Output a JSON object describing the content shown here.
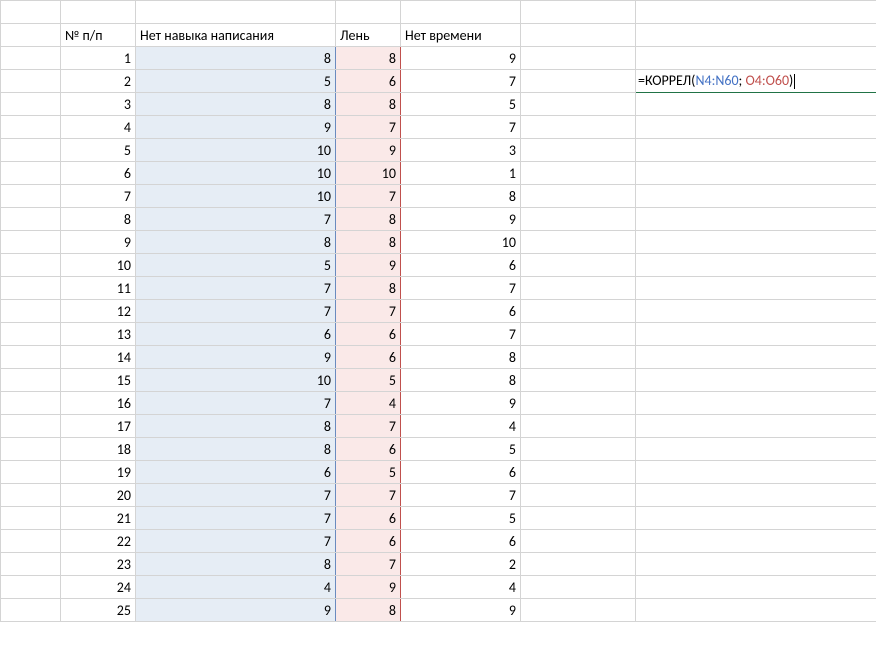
{
  "headers": {
    "index": "№ п/п",
    "col1": "Нет навыка написания",
    "col2": "Лень",
    "col3": "Нет времени"
  },
  "formula": {
    "prefix": "=КОРРЕЛ(",
    "arg1": "N4:N60",
    "sep": "; ",
    "arg2": "O4:O60",
    "suffix": ")"
  },
  "rows": [
    {
      "n": "1",
      "a": "8",
      "b": "8",
      "c": "9"
    },
    {
      "n": "2",
      "a": "5",
      "b": "6",
      "c": "7"
    },
    {
      "n": "3",
      "a": "8",
      "b": "8",
      "c": "5"
    },
    {
      "n": "4",
      "a": "9",
      "b": "7",
      "c": "7"
    },
    {
      "n": "5",
      "a": "10",
      "b": "9",
      "c": "3"
    },
    {
      "n": "6",
      "a": "10",
      "b": "10",
      "c": "1"
    },
    {
      "n": "7",
      "a": "10",
      "b": "7",
      "c": "8"
    },
    {
      "n": "8",
      "a": "7",
      "b": "8",
      "c": "9"
    },
    {
      "n": "9",
      "a": "8",
      "b": "8",
      "c": "10"
    },
    {
      "n": "10",
      "a": "5",
      "b": "9",
      "c": "6"
    },
    {
      "n": "11",
      "a": "7",
      "b": "8",
      "c": "7"
    },
    {
      "n": "12",
      "a": "7",
      "b": "7",
      "c": "6"
    },
    {
      "n": "13",
      "a": "6",
      "b": "6",
      "c": "7"
    },
    {
      "n": "14",
      "a": "9",
      "b": "6",
      "c": "8"
    },
    {
      "n": "15",
      "a": "10",
      "b": "5",
      "c": "8"
    },
    {
      "n": "16",
      "a": "7",
      "b": "4",
      "c": "9"
    },
    {
      "n": "17",
      "a": "8",
      "b": "7",
      "c": "4"
    },
    {
      "n": "18",
      "a": "8",
      "b": "6",
      "c": "5"
    },
    {
      "n": "19",
      "a": "6",
      "b": "5",
      "c": "6"
    },
    {
      "n": "20",
      "a": "7",
      "b": "7",
      "c": "7"
    },
    {
      "n": "21",
      "a": "7",
      "b": "6",
      "c": "5"
    },
    {
      "n": "22",
      "a": "7",
      "b": "6",
      "c": "6"
    },
    {
      "n": "23",
      "a": "8",
      "b": "7",
      "c": "2"
    },
    {
      "n": "24",
      "a": "4",
      "b": "9",
      "c": "4"
    },
    {
      "n": "25",
      "a": "9",
      "b": "8",
      "c": "9"
    }
  ]
}
